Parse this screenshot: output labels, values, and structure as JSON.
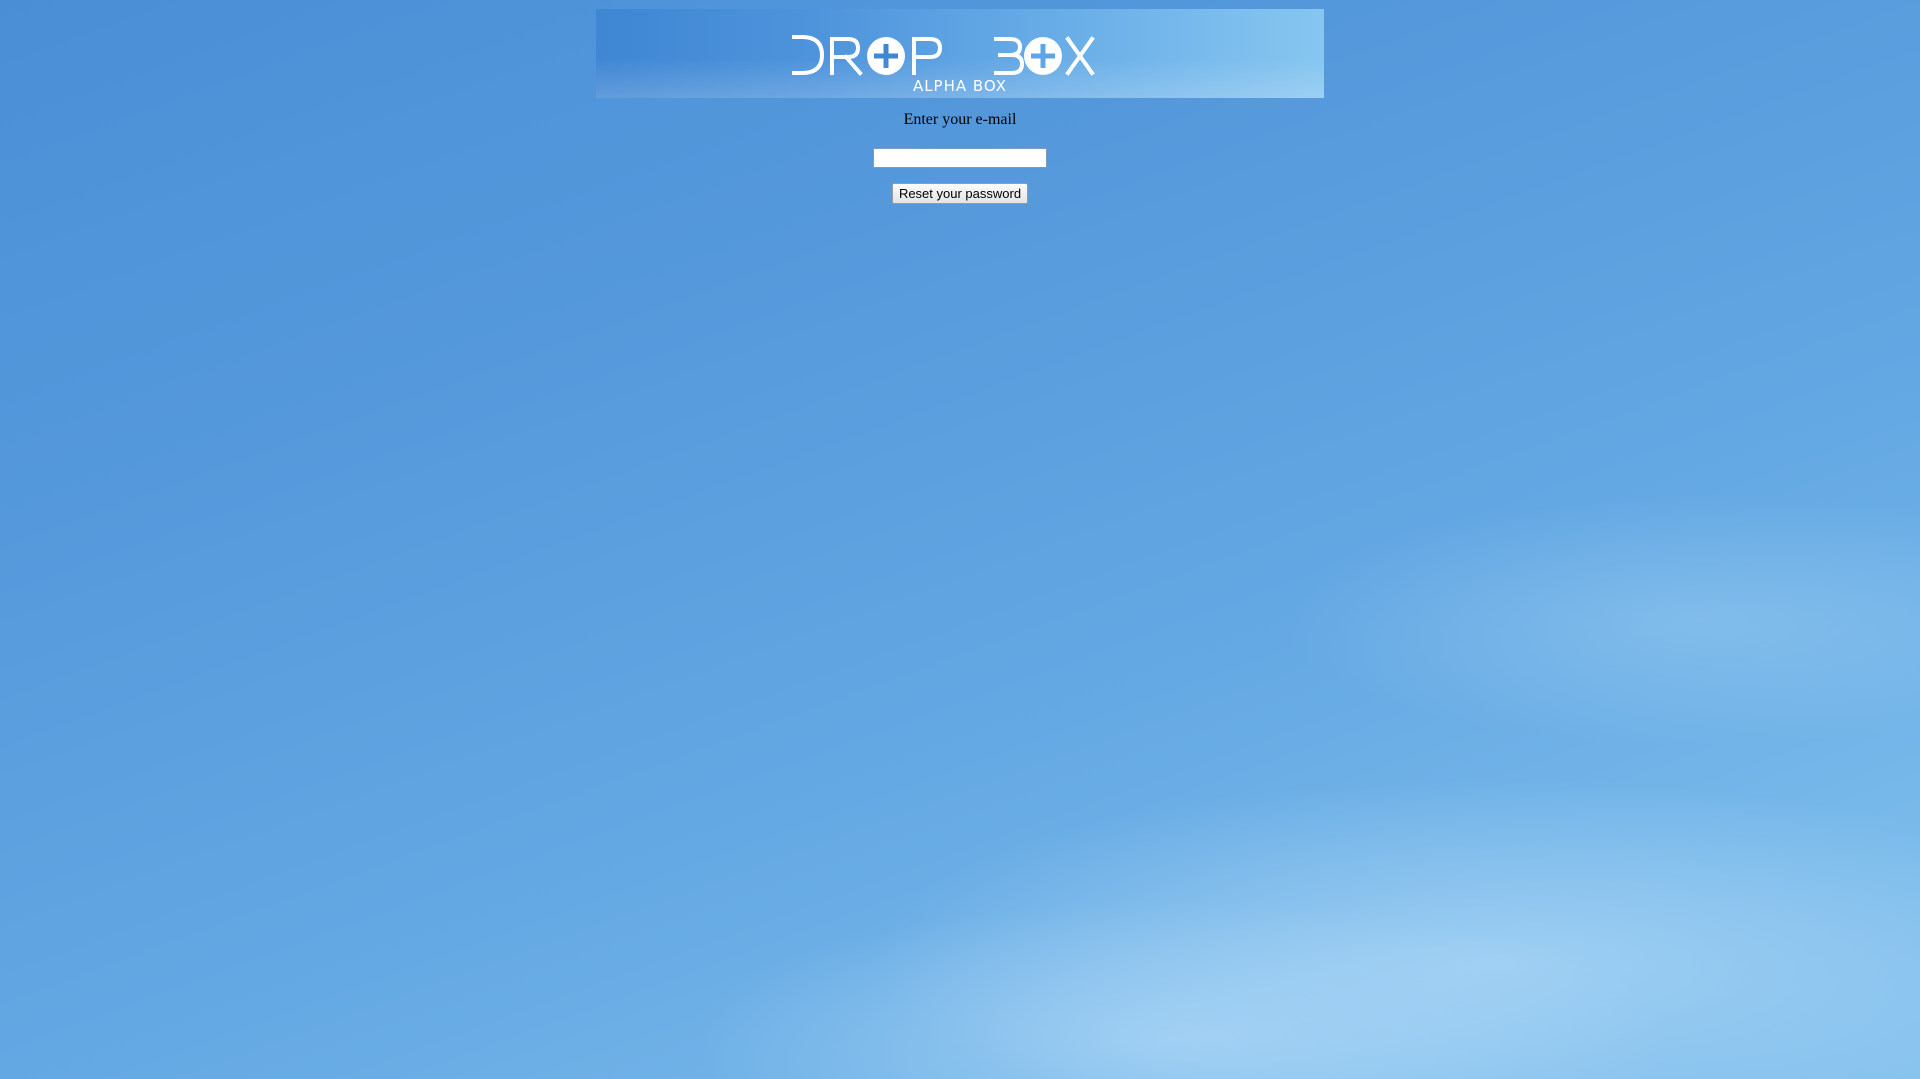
{
  "banner": {
    "logo_text": "DROP BOX",
    "subtitle": "ALPHA BOX"
  },
  "form": {
    "email_label": "Enter your e-mail",
    "email_value": "",
    "email_placeholder": "",
    "reset_button_label": "Reset your password"
  },
  "colors": {
    "background": "#5599dc",
    "banner": "#4e94dc",
    "logo": "#ffffff"
  }
}
